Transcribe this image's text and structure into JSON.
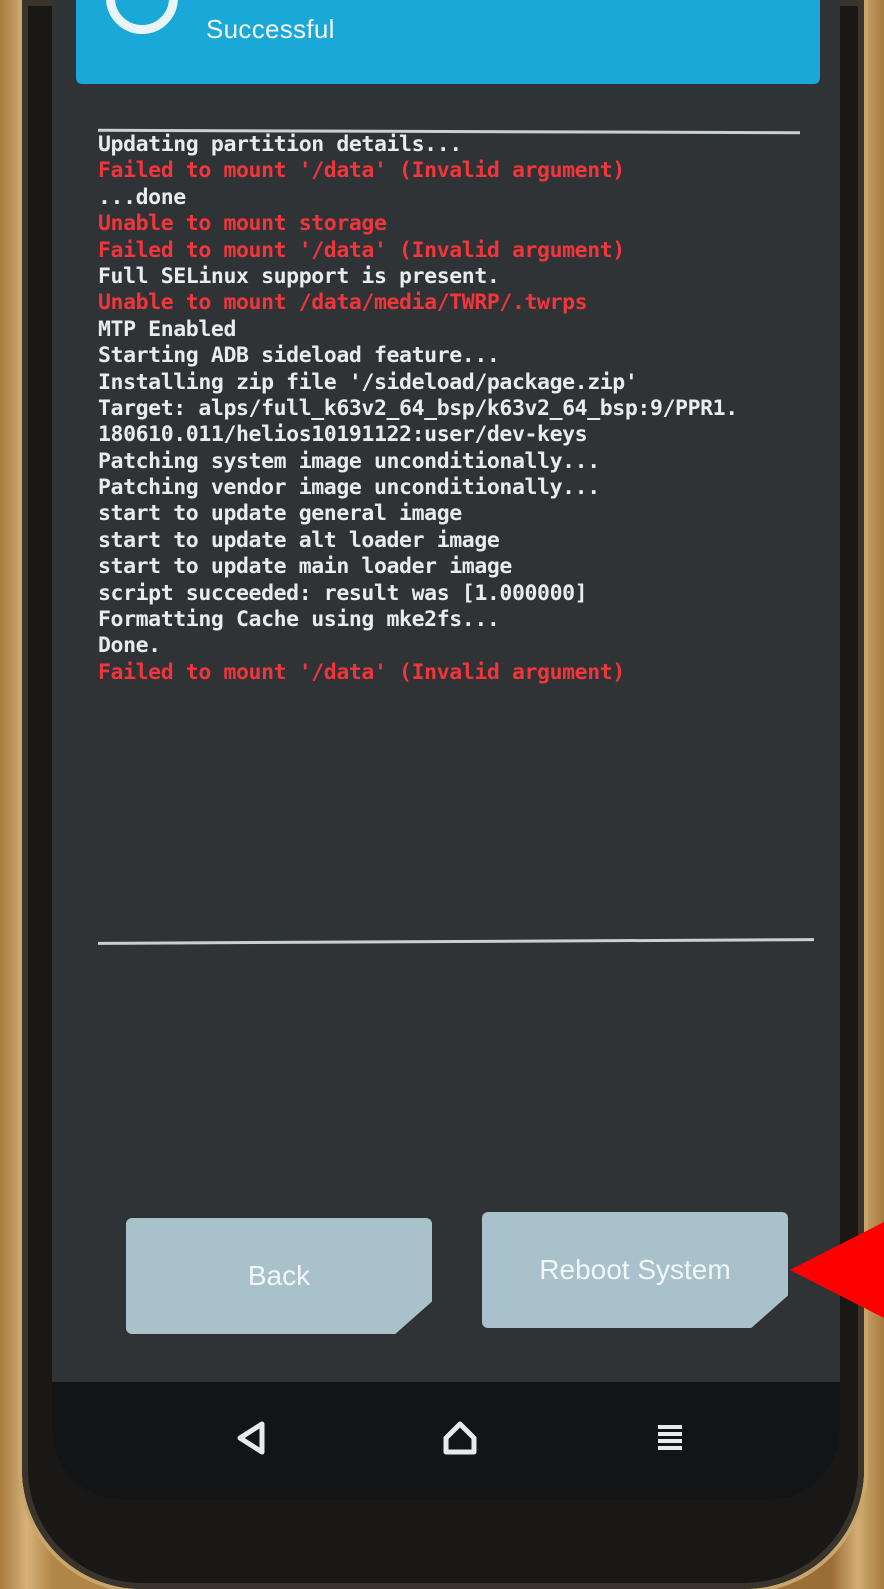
{
  "header": {
    "title": "Successful"
  },
  "console": {
    "lines": [
      {
        "text": "Updating partition details...",
        "type": "normal"
      },
      {
        "text": "Failed to mount '/data' (Invalid argument)",
        "type": "error"
      },
      {
        "text": "...done",
        "type": "normal"
      },
      {
        "text": "Unable to mount storage",
        "type": "error"
      },
      {
        "text": "Failed to mount '/data' (Invalid argument)",
        "type": "error"
      },
      {
        "text": "Full SELinux support is present.",
        "type": "normal"
      },
      {
        "text": "Unable to mount /data/media/TWRP/.twrps",
        "type": "error"
      },
      {
        "text": "MTP Enabled",
        "type": "normal"
      },
      {
        "text": "Starting ADB sideload feature...",
        "type": "normal"
      },
      {
        "text": "Installing zip file '/sideload/package.zip'",
        "type": "normal"
      },
      {
        "text": "Target: alps/full_k63v2_64_bsp/k63v2_64_bsp:9/PPR1.",
        "type": "normal"
      },
      {
        "text": "180610.011/helios10191122:user/dev-keys",
        "type": "normal"
      },
      {
        "text": "Patching system image unconditionally...",
        "type": "normal"
      },
      {
        "text": "Patching vendor image unconditionally...",
        "type": "normal"
      },
      {
        "text": "start to update general image",
        "type": "normal"
      },
      {
        "text": "start to update alt loader image",
        "type": "normal"
      },
      {
        "text": "start to update main loader image",
        "type": "normal"
      },
      {
        "text": "script succeeded: result was [1.000000]",
        "type": "normal"
      },
      {
        "text": "Formatting Cache using mke2fs...",
        "type": "normal"
      },
      {
        "text": "Done.",
        "type": "normal"
      },
      {
        "text": "Failed to mount '/data' (Invalid argument)",
        "type": "error"
      }
    ]
  },
  "buttons": {
    "back_label": "Back",
    "reboot_label": "Reboot System"
  },
  "navbar": {
    "back_icon": "back-triangle",
    "home_icon": "home-house",
    "menu_icon": "menu-lines"
  },
  "colors": {
    "header": "#1aa8d8",
    "screen_bg": "#2f3336",
    "error_text": "#f0363b",
    "normal_text": "#e6ecef",
    "button_bg": "#a9c1cb",
    "annotation_arrow": "#ff0000"
  }
}
